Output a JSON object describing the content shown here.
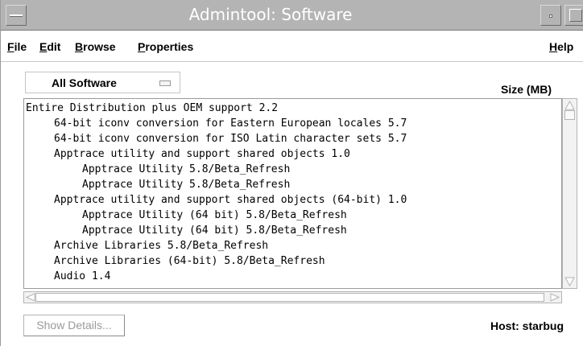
{
  "window": {
    "title": "Admintool: Software"
  },
  "menubar": {
    "items": [
      {
        "label": "File",
        "mnemonic": "F",
        "rest": "ile"
      },
      {
        "label": "Edit",
        "mnemonic": "E",
        "rest": "dit"
      },
      {
        "label": "Browse",
        "mnemonic": "B",
        "rest": "rowse"
      },
      {
        "label": "Properties",
        "mnemonic": "P",
        "rest": "roperties"
      },
      {
        "label": "Help",
        "mnemonic": "H",
        "rest": "elp"
      }
    ]
  },
  "filter": {
    "selected": "All Software"
  },
  "list": {
    "size_header": "Size (MB)",
    "items": [
      {
        "text": "Entire Distribution plus OEM support 2.2",
        "level": 0
      },
      {
        "text": "64-bit iconv conversion for Eastern European locales 5.7",
        "level": 1
      },
      {
        "text": "64-bit iconv conversion for ISO Latin character sets 5.7",
        "level": 1
      },
      {
        "text": "Apptrace utility and support shared objects 1.0",
        "level": 1
      },
      {
        "text": "Apptrace Utility 5.8/Beta_Refresh",
        "level": 2
      },
      {
        "text": "Apptrace Utility 5.8/Beta_Refresh",
        "level": 2
      },
      {
        "text": "Apptrace utility and support shared objects (64-bit) 1.0",
        "level": 1
      },
      {
        "text": "Apptrace Utility (64 bit) 5.8/Beta_Refresh",
        "level": 2
      },
      {
        "text": "Apptrace Utility (64 bit) 5.8/Beta_Refresh",
        "level": 2
      },
      {
        "text": "Archive Libraries 5.8/Beta_Refresh",
        "level": 1
      },
      {
        "text": "Archive Libraries (64-bit) 5.8/Beta_Refresh",
        "level": 1
      },
      {
        "text": "Audio 1.4",
        "level": 1
      }
    ]
  },
  "footer": {
    "details_label": "Show Details...",
    "host_label": "Host: starbug"
  },
  "colors": {
    "titlebar": "#b4b4b4",
    "title_text": "#ffffff",
    "disabled_text": "#9a9a9a"
  }
}
